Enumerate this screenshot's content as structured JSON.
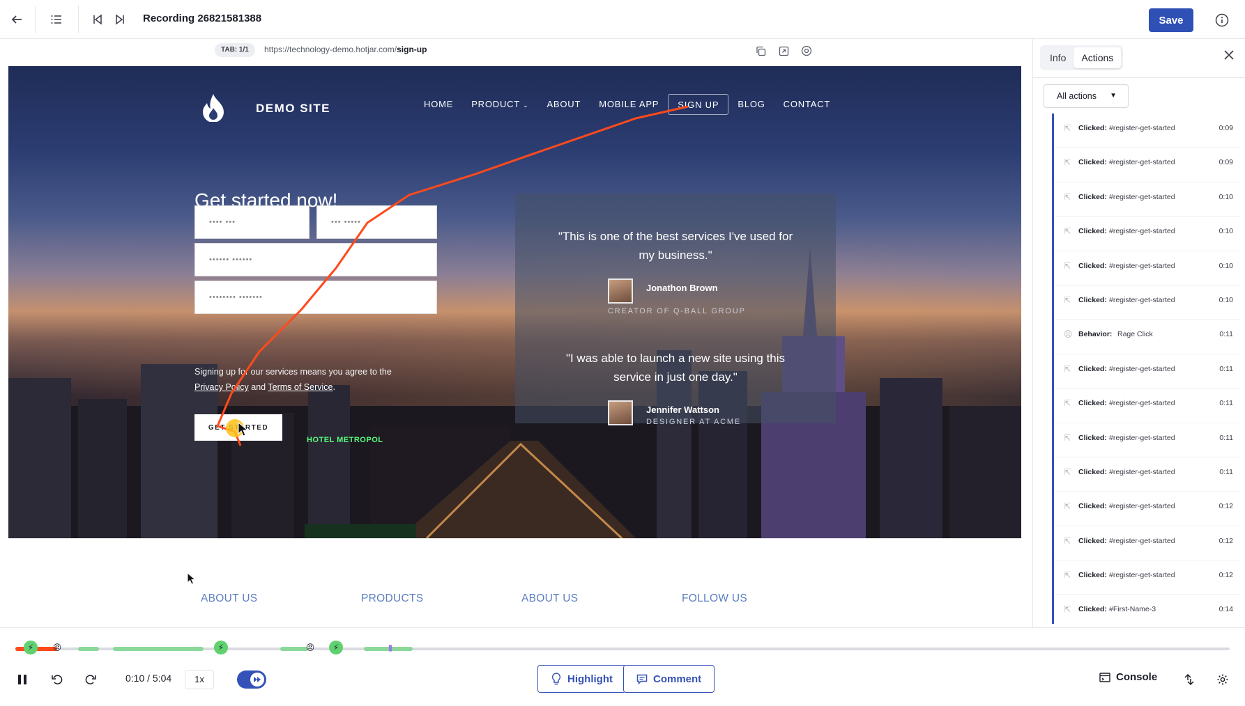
{
  "topbar": {
    "title": "Recording 26821581388",
    "save_label": "Save"
  },
  "urlbar": {
    "tab": "TAB: 1/1",
    "url_prefix": "https://technology-demo.hotjar.com/",
    "url_path": "sign-up"
  },
  "site": {
    "brand": "DEMO SITE",
    "nav": [
      {
        "label": "HOME",
        "active": false
      },
      {
        "label": "PRODUCT",
        "active": false
      },
      {
        "label": "ABOUT",
        "active": false
      },
      {
        "label": "MOBILE APP",
        "active": false
      },
      {
        "label": "SIGN UP",
        "active": true
      },
      {
        "label": "BLOG",
        "active": false
      },
      {
        "label": "CONTACT",
        "active": false
      }
    ],
    "headline": "Get started now!",
    "fields": [
      "•••• •••",
      "••• •••••",
      "•••••• ••••••",
      "•••••••• •••••••"
    ],
    "legal_text": "Signing up for our services means you agree to the",
    "privacy": "Privacy Policy",
    "and": "and",
    "terms": "Terms of Service",
    "legal_end": ".",
    "cta": "GET STARTED",
    "testimonials": [
      {
        "quote": "\"This is one of the best services I've used for my business.\"",
        "author": "Jonathon Brown",
        "role": "CREATOR OF Q-BALL GROUP"
      },
      {
        "quote": "\"I was able to launch a new site using this service in just one day.\"",
        "author": "Jennifer Wattson",
        "role": "DESIGNER AT ACME"
      }
    ],
    "sign_text": "HOTEL METROPOL",
    "footer_links": [
      "ABOUT US",
      "PRODUCTS",
      "ABOUT US",
      "FOLLOW US"
    ]
  },
  "panel": {
    "tabs": [
      {
        "label": "Info",
        "active": false
      },
      {
        "label": "Actions",
        "active": true
      }
    ],
    "filter": "All actions",
    "actions": [
      {
        "label": "Clicked:",
        "target": "#register-get-started",
        "time": "0:09",
        "icon": "cursor-icon"
      },
      {
        "label": "Clicked:",
        "target": "#register-get-started",
        "time": "0:09",
        "icon": "cursor-icon"
      },
      {
        "label": "Clicked:",
        "target": "#register-get-started",
        "time": "0:10",
        "icon": "cursor-icon"
      },
      {
        "label": "Clicked:",
        "target": "#register-get-started",
        "time": "0:10",
        "icon": "cursor-icon"
      },
      {
        "label": "Clicked:",
        "target": "#register-get-started",
        "time": "0:10",
        "icon": "cursor-icon"
      },
      {
        "label": "Clicked:",
        "target": "#register-get-started",
        "time": "0:10",
        "icon": "cursor-icon"
      },
      {
        "label": "Behavior:",
        "target": "Rage Click",
        "time": "0:11",
        "icon": "rage-icon"
      },
      {
        "label": "Clicked:",
        "target": "#register-get-started",
        "time": "0:11",
        "icon": "cursor-icon"
      },
      {
        "label": "Clicked:",
        "target": "#register-get-started",
        "time": "0:11",
        "icon": "cursor-icon"
      },
      {
        "label": "Clicked:",
        "target": "#register-get-started",
        "time": "0:11",
        "icon": "cursor-icon"
      },
      {
        "label": "Clicked:",
        "target": "#register-get-started",
        "time": "0:11",
        "icon": "cursor-icon"
      },
      {
        "label": "Clicked:",
        "target": "#register-get-started",
        "time": "0:12",
        "icon": "cursor-icon"
      },
      {
        "label": "Clicked:",
        "target": "#register-get-started",
        "time": "0:12",
        "icon": "cursor-icon"
      },
      {
        "label": "Clicked:",
        "target": "#register-get-started",
        "time": "0:12",
        "icon": "cursor-icon"
      },
      {
        "label": "Clicked:",
        "target": "#First-Name-3",
        "time": "0:14",
        "icon": "cursor-icon"
      }
    ]
  },
  "player": {
    "time": "0:10 / 5:04",
    "speed": "1x",
    "highlight_label": "Highlight",
    "comment_label": "Comment",
    "console_label": "Console",
    "progress_fraction": 0.033
  },
  "colors": {
    "accent": "#3552b8",
    "save": "#2f51b5",
    "trail": "#ff4a1c",
    "footer_link": "#5b7fc0"
  }
}
